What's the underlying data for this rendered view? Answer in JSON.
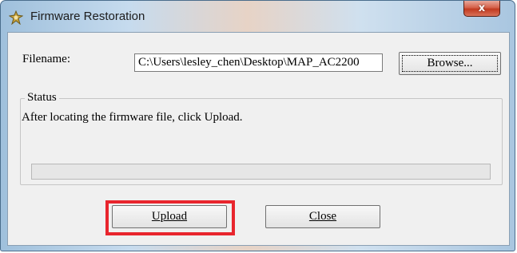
{
  "window": {
    "title": "Firmware Restoration",
    "close_glyph": "x"
  },
  "filename": {
    "label": "Filename:",
    "value": "C:\\Users\\lesley_chen\\Desktop\\MAP_AC2200"
  },
  "buttons": {
    "browse": "Browse...",
    "upload": "Upload",
    "close": "Close"
  },
  "status": {
    "legend": "Status",
    "message": "After locating the firmware file, click Upload.",
    "progress_percent": 0
  },
  "icons": {
    "app": "firmware-restore-icon",
    "close": "close-icon"
  },
  "colors": {
    "highlight": "#e8252d",
    "close_button": "#c13a20",
    "progress_fill": "#37c04a"
  }
}
